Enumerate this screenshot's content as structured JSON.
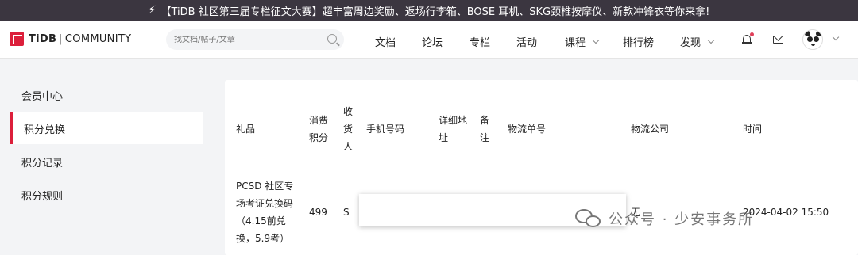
{
  "banner": {
    "icon": "lightning-icon",
    "text": "【TiDB 社区第三届专栏征文大赛】超丰富周边奖励、返场行李箱、BOSE 耳机、SKG颈椎按摩仪、新款冲锋衣等你来拿!"
  },
  "header": {
    "logo_brand": "TiDB",
    "logo_sep": "|",
    "logo_sub": "COMMUNITY",
    "search_placeholder": "找文档/帖子/文章",
    "nav": [
      {
        "label": "文档"
      },
      {
        "label": "论坛"
      },
      {
        "label": "专栏"
      },
      {
        "label": "活动"
      },
      {
        "label": "课程"
      },
      {
        "label": "排行榜"
      },
      {
        "label": "发现"
      }
    ]
  },
  "sidebar": {
    "items": [
      {
        "label": "会员中心"
      },
      {
        "label": "积分兑换"
      },
      {
        "label": "积分记录"
      },
      {
        "label": "积分规则"
      }
    ],
    "active_index": 1
  },
  "table": {
    "headers": {
      "gift": "礼品",
      "points_1": "消费",
      "points_2": "积分",
      "recv_1": "收",
      "recv_2": "货",
      "recv_3": "人",
      "phone": "手机号码",
      "addr_1": "详细地",
      "addr_2": "址",
      "note_1": "备",
      "note_2": "注",
      "tracking": "物流单号",
      "company": "物流公司",
      "time": "时间"
    },
    "row": {
      "gift_1": "PCSD 社区专",
      "gift_2": "场考证兑换码",
      "gift_3": "（4.15前兑",
      "gift_4": "换，5.9考）",
      "points": "499",
      "receiver": "S",
      "company": "无",
      "time": "2024-04-02 15:50"
    }
  },
  "watermark": {
    "text": "公众号 · 少安事务所"
  },
  "colors": {
    "accent": "#dc1f3b",
    "banner_bg": "#3b3640",
    "page_bg": "#f3f4f6"
  }
}
